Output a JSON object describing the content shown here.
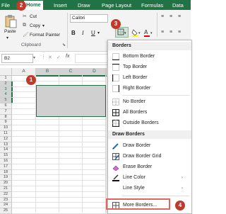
{
  "ribbon": {
    "tabs": [
      {
        "label": "File",
        "active": false
      },
      {
        "label": "Home",
        "active": true
      },
      {
        "label": "Insert",
        "active": false
      },
      {
        "label": "Draw",
        "active": false
      },
      {
        "label": "Page Layout",
        "active": false
      },
      {
        "label": "Formulas",
        "active": false
      },
      {
        "label": "Data",
        "active": false
      }
    ],
    "clipboard": {
      "cut": "Cut",
      "copy": "Copy",
      "format_painter": "Format Painter",
      "paste": "Paste",
      "group": "Clipboard"
    },
    "font": {
      "name": "Calibri",
      "bold": "B",
      "italic": "I",
      "underline": "U"
    }
  },
  "formula_bar": {
    "name_box": "B2",
    "fx": "fx"
  },
  "sheet": {
    "columns": [
      "A",
      "B",
      "C",
      "D"
    ],
    "rows": [
      "1",
      "2",
      "3",
      "4",
      "5",
      "6",
      "7",
      "8",
      "9",
      "10",
      "11",
      "12",
      "13",
      "14",
      "15",
      "16",
      "17",
      "18",
      "19",
      "20",
      "21",
      "22",
      "23",
      "24",
      "25"
    ],
    "selected_columns": [
      "B",
      "C",
      "D"
    ],
    "selected_rows": [
      "2",
      "3",
      "4",
      "5"
    ]
  },
  "menu": {
    "borders_header": "Borders",
    "borders_items": [
      {
        "label": "Bottom Border",
        "icon": "bottom-border-icon"
      },
      {
        "label": "Top Border",
        "icon": "top-border-icon"
      },
      {
        "label": "Left Border",
        "icon": "left-border-icon"
      },
      {
        "label": "Right Border",
        "icon": "right-border-icon"
      },
      {
        "label": "No Border",
        "icon": "no-border-icon"
      },
      {
        "label": "All Borders",
        "icon": "all-borders-icon"
      },
      {
        "label": "Outside Borders",
        "icon": "outside-borders-icon"
      }
    ],
    "draw_header": "Draw Borders",
    "draw_items": [
      {
        "label": "Draw Border",
        "icon": "pencil-icon"
      },
      {
        "label": "Draw Border Grid",
        "icon": "grid-pencil-icon"
      },
      {
        "label": "Erase Border",
        "icon": "eraser-icon"
      },
      {
        "label": "Line Color",
        "icon": "line-color-icon"
      },
      {
        "label": "Line Style",
        "icon": "line-style-icon"
      }
    ],
    "more_borders": "More Borders..."
  },
  "callouts": [
    "1",
    "2",
    "3",
    "4"
  ],
  "colors": {
    "excel_green": "#217346",
    "callout_red": "#c0392b",
    "highlight": "#e06666"
  }
}
